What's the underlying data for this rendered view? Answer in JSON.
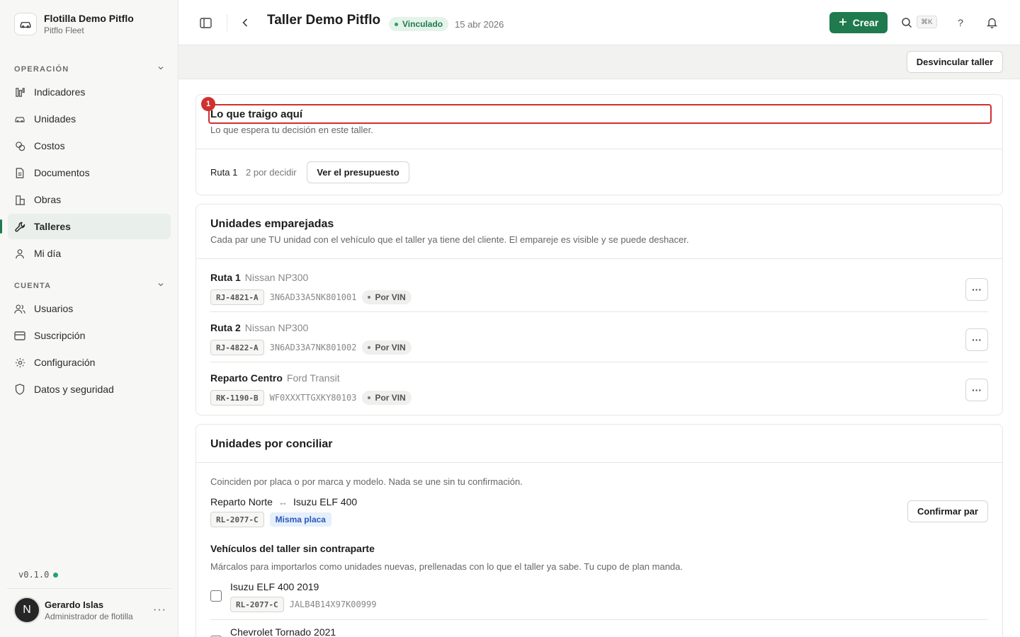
{
  "brand": {
    "title": "Flotilla Demo Pitflo",
    "subtitle": "Pitflo Fleet",
    "icon": "car-icon"
  },
  "sidebar": {
    "section_operacion": "OPERACIÓN",
    "operacion_items": [
      {
        "label": "Indicadores",
        "icon": "chart-icon"
      },
      {
        "label": "Unidades",
        "icon": "car-icon"
      },
      {
        "label": "Costos",
        "icon": "coins-icon"
      },
      {
        "label": "Documentos",
        "icon": "document-icon"
      },
      {
        "label": "Obras",
        "icon": "building-icon"
      },
      {
        "label": "Talleres",
        "icon": "wrench-icon",
        "active": true
      },
      {
        "label": "Mi día",
        "icon": "user-icon"
      }
    ],
    "section_cuenta": "CUENTA",
    "cuenta_items": [
      {
        "label": "Usuarios",
        "icon": "users-icon"
      },
      {
        "label": "Suscripción",
        "icon": "card-icon"
      },
      {
        "label": "Configuración",
        "icon": "gear-icon"
      },
      {
        "label": "Datos y seguridad",
        "icon": "shield-icon"
      }
    ],
    "version": "v0.1.0",
    "user": {
      "initial": "N",
      "name": "Gerardo Islas",
      "role": "Administrador de flotilla"
    }
  },
  "topbar": {
    "title": "Taller Demo Pitflo",
    "status": "Vinculado",
    "date": "15 abr 2026",
    "create_label": "Crear",
    "shortcut": "⌘K",
    "help": "?"
  },
  "actionbar": {
    "unlink_label": "Desvincular taller"
  },
  "pending": {
    "marker": "1",
    "title": "Lo que traigo aquí",
    "description": "Lo que espera tu decisión en este taller.",
    "route": "Ruta 1",
    "count": "2 por decidir",
    "button": "Ver el presupuesto"
  },
  "paired": {
    "title": "Unidades emparejadas",
    "description": "Cada par une TU unidad con el vehículo que el taller ya tiene del cliente. El empareje es visible y se puede deshacer.",
    "units": [
      {
        "name": "Ruta 1",
        "model": "Nissan NP300",
        "plate": "RJ-4821-A",
        "vin": "3N6AD33A5NK801001",
        "match": "Por VIN"
      },
      {
        "name": "Ruta 2",
        "model": "Nissan NP300",
        "plate": "RJ-4822-A",
        "vin": "3N6AD33A7NK801002",
        "match": "Por VIN"
      },
      {
        "name": "Reparto Centro",
        "model": "Ford Transit",
        "plate": "RK-1190-B",
        "vin": "WF0XXXTTGXKY80103",
        "match": "Por VIN"
      }
    ]
  },
  "reconcile": {
    "title": "Unidades por conciliar",
    "description": "Coinciden por placa o por marca y modelo. Nada se une sin tu confirmación.",
    "candidate": {
      "unit": "Reparto Norte",
      "arrow": "↔",
      "vehicle": "Isuzu ELF 400",
      "plate": "RL-2077-C",
      "reason": "Misma placa",
      "button": "Confirmar par"
    },
    "orphans_title": "Vehículos del taller sin contraparte",
    "orphans_description": "Márcalos para importarlos como unidades nuevas, prellenadas con lo que el taller ya sabe. Tu cupo de plan manda.",
    "orphans": [
      {
        "name": "Isuzu ELF 400 2019",
        "plate": "RL-2077-C",
        "vin": "JALB4B14X97K00999"
      },
      {
        "name": "Chevrolet Tornado 2021"
      }
    ]
  }
}
